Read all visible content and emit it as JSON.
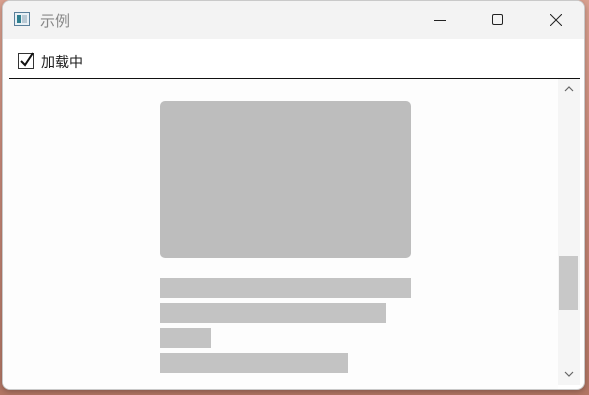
{
  "window": {
    "title": "示例",
    "icon": "app-window-icon"
  },
  "titlebar": {
    "minimize_icon": "minimize-icon",
    "maximize_icon": "maximize-icon",
    "close_icon": "close-icon"
  },
  "toolbar": {
    "checkbox_label": "加载中",
    "checkbox_checked": true
  },
  "content": {
    "state": "loading-skeleton",
    "skeleton_color": "#bdbdbd"
  },
  "scrollbar": {
    "up_icon": "chevron-up-icon",
    "down_icon": "chevron-down-icon"
  }
}
